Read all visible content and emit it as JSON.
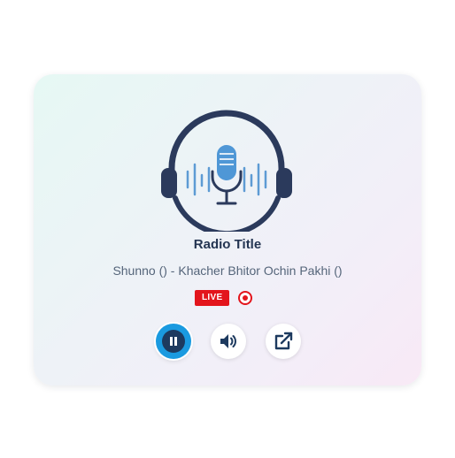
{
  "player": {
    "title": "Radio Title",
    "track": "Shunno () - Khacher Bhitor Ochin Pakhi ()",
    "live_label": "LIVE",
    "logo_icon": "podcast-microphone-headphones-icon",
    "colors": {
      "live": "#e3151c",
      "accent": "#1a9ae0",
      "dark": "#243552"
    }
  },
  "controls": {
    "pause_icon": "pause-icon",
    "volume_icon": "volume-icon",
    "popout_icon": "external-link-icon"
  }
}
